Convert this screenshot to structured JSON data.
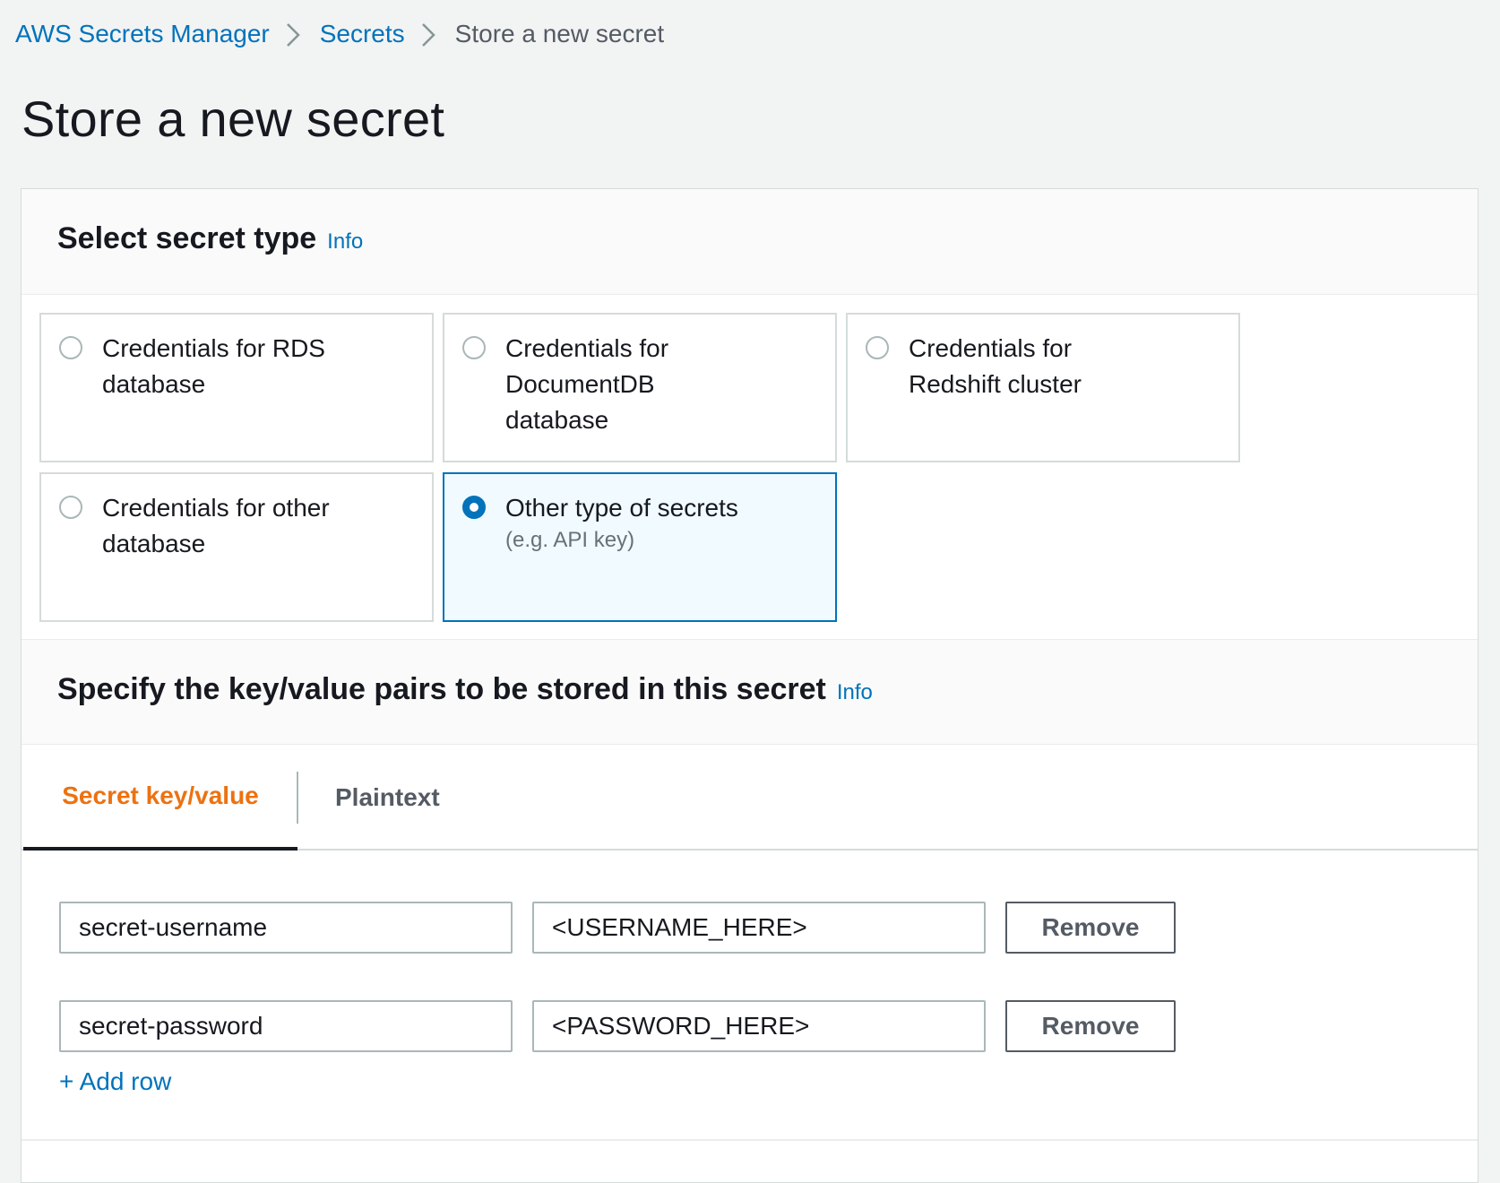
{
  "breadcrumb": {
    "items": [
      "AWS Secrets Manager",
      "Secrets"
    ],
    "current": "Store a new secret"
  },
  "page": {
    "title": "Store a new secret"
  },
  "secret_type": {
    "heading": "Select secret type",
    "info": "Info",
    "options": [
      {
        "label": "Credentials for RDS database",
        "selected": false
      },
      {
        "label": "Credentials for DocumentDB database",
        "selected": false
      },
      {
        "label": "Credentials for Redshift cluster",
        "selected": false
      },
      {
        "label": "Credentials for other database",
        "selected": false
      },
      {
        "label": "Other type of secrets",
        "description": "(e.g. API key)",
        "selected": true
      }
    ]
  },
  "kv_section": {
    "heading": "Specify the key/value pairs to be stored in this secret",
    "info": "Info",
    "tabs": [
      {
        "label": "Secret key/value",
        "active": true
      },
      {
        "label": "Plaintext",
        "active": false
      }
    ],
    "rows": [
      {
        "key": "secret-username",
        "value": "<USERNAME_HERE>",
        "remove_label": "Remove"
      },
      {
        "key": "secret-password",
        "value": "<PASSWORD_HERE>",
        "remove_label": "Remove"
      }
    ],
    "add_row_label": "+ Add row"
  },
  "colors": {
    "link": "#0073bb",
    "active_tab": "#ec7211",
    "selected_tile_bg": "#f1faff"
  }
}
